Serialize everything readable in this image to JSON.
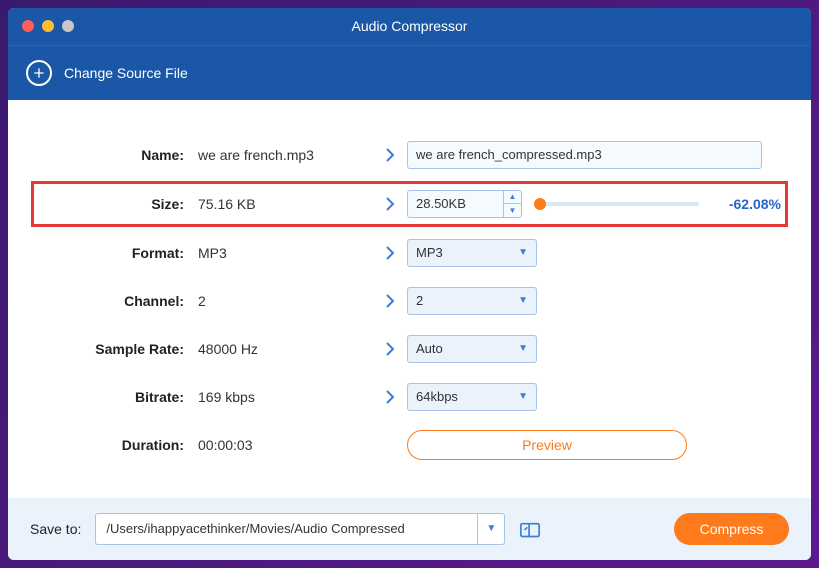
{
  "title": "Audio Compressor",
  "toolbar": {
    "change_source": "Change Source File"
  },
  "rows": {
    "name": {
      "label": "Name:",
      "src": "we are french.mp3",
      "out": "we are french_compressed.mp3"
    },
    "size": {
      "label": "Size:",
      "src": "75.16 KB",
      "out": "28.50KB",
      "percent": "-62.08%"
    },
    "format": {
      "label": "Format:",
      "src": "MP3",
      "out": "MP3"
    },
    "channel": {
      "label": "Channel:",
      "src": "2",
      "out": "2"
    },
    "sample_rate": {
      "label": "Sample Rate:",
      "src": "48000 Hz",
      "out": "Auto"
    },
    "bitrate": {
      "label": "Bitrate:",
      "src": "169 kbps",
      "out": "64kbps"
    },
    "duration": {
      "label": "Duration:",
      "src": "00:00:03"
    }
  },
  "preview": "Preview",
  "footer": {
    "save_to": "Save to:",
    "path": "/Users/ihappyacethinker/Movies/Audio Compressed",
    "compress": "Compress"
  }
}
